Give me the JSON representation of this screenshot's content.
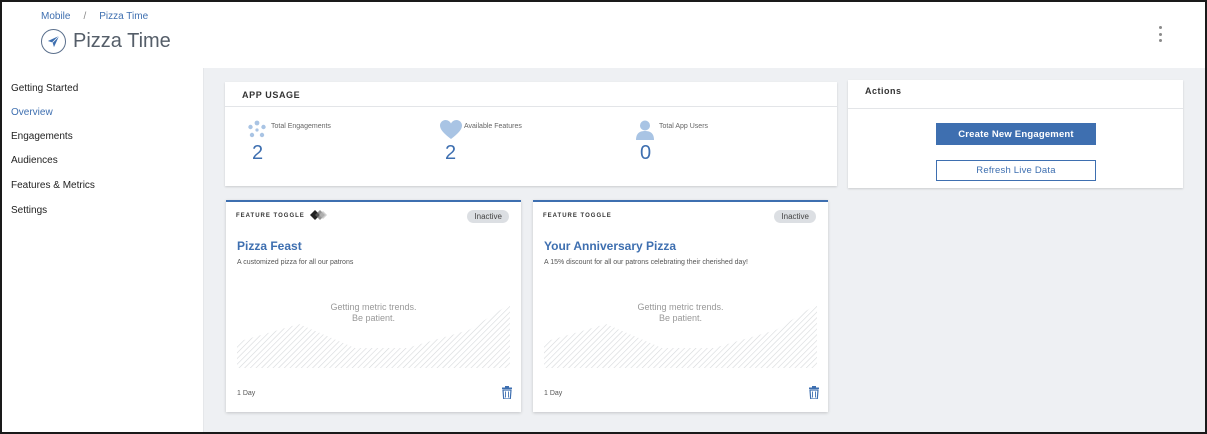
{
  "breadcrumb": {
    "parent": "Mobile",
    "separator": "/",
    "current": "Pizza Time"
  },
  "header": {
    "title": "Pizza Time",
    "app_icon": "paper-plane-icon",
    "menu_icon": "kebab-menu-icon"
  },
  "sidebar": {
    "items": [
      {
        "label": "Getting Started",
        "active": false
      },
      {
        "label": "Overview",
        "active": true
      },
      {
        "label": "Engagements",
        "active": false
      },
      {
        "label": "Audiences",
        "active": false
      },
      {
        "label": "Features & Metrics",
        "active": false
      },
      {
        "label": "Settings",
        "active": false
      }
    ]
  },
  "usage": {
    "title": "APP USAGE",
    "stats": [
      {
        "label": "Total Engagements",
        "value": "2",
        "icon": "sparkle-icon"
      },
      {
        "label": "Available Features",
        "value": "2",
        "icon": "heart-icon"
      },
      {
        "label": "Total App Users",
        "value": "0",
        "icon": "user-icon"
      }
    ]
  },
  "actions": {
    "title": "Actions",
    "create_label": "Create New Engagement",
    "refresh_label": "Refresh Live Data"
  },
  "cards": [
    {
      "type_label": "FEATURE TOGGLE",
      "status": "Inactive",
      "title": "Pizza Feast",
      "description": "A customized pizza for all our patrons",
      "metric_line1": "Getting metric trends.",
      "metric_line2": "Be patient.",
      "duration": "1 Day"
    },
    {
      "type_label": "FEATURE TOGGLE",
      "status": "Inactive",
      "title": "Your Anniversary Pizza",
      "description": "A 15% discount for all our patrons celebrating their cherished day!",
      "metric_line1": "Getting metric trends.",
      "metric_line2": "Be patient.",
      "duration": "1 Day"
    }
  ],
  "colors": {
    "accent": "#3e6fb0",
    "background": "#eef0f3",
    "badge": "#dcdfe3"
  }
}
